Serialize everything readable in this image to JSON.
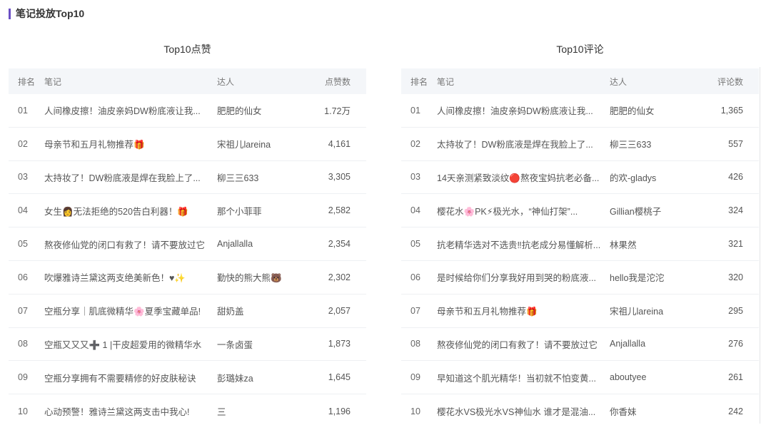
{
  "section_title": "笔记投放Top10",
  "accent_color": "#6a4fc4",
  "tables": [
    {
      "subtitle": "Top10点赞",
      "headers": {
        "rank": "排名",
        "note": "笔记",
        "author": "达人",
        "count": "点赞数"
      },
      "rows": [
        {
          "rank": "01",
          "note": "人间橡皮擦！油皮亲妈DW粉底液让我...",
          "author": "肥肥的仙女",
          "count": "1.72万"
        },
        {
          "rank": "02",
          "note": "母亲节和五月礼物推荐🎁",
          "author": "宋祖儿lareina",
          "count": "4,161"
        },
        {
          "rank": "03",
          "note": "太持妆了！DW粉底液是焊在我脸上了...",
          "author": "柳三三633",
          "count": "3,305"
        },
        {
          "rank": "04",
          "note": "女生👩无法拒绝的520告白利器！🎁",
          "author": "那个小菲菲",
          "count": "2,582"
        },
        {
          "rank": "05",
          "note": "熬夜修仙党的闭口有救了！请不要放过它",
          "author": "Anjallalla",
          "count": "2,354"
        },
        {
          "rank": "06",
          "note": "吹爆雅诗兰黛这两支绝美新色！♥✨",
          "author": "勤快的熊大熊🐻",
          "count": "2,302"
        },
        {
          "rank": "07",
          "note": "空瓶分享｜肌底微精华🌸夏季宝藏单品!",
          "author": "甜奶盖",
          "count": "2,057"
        },
        {
          "rank": "08",
          "note": "空瓶又又又➕ 1 |干皮超爱用的微精华水",
          "author": "一条卤蛋",
          "count": "1,873"
        },
        {
          "rank": "09",
          "note": "空瓶分享拥有不需要精修的好皮肤秘诀",
          "author": "彭璐妹za",
          "count": "1,645"
        },
        {
          "rank": "10",
          "note": "心动预警！雅诗兰黛这两支击中我心!",
          "author": "三",
          "count": "1,196"
        }
      ]
    },
    {
      "subtitle": "Top10评论",
      "headers": {
        "rank": "排名",
        "note": "笔记",
        "author": "达人",
        "count": "评论数"
      },
      "rows": [
        {
          "rank": "01",
          "note": "人间橡皮擦！油皮亲妈DW粉底液让我...",
          "author": "肥肥的仙女",
          "count": "1,365"
        },
        {
          "rank": "02",
          "note": "太持妆了！DW粉底液是焊在我脸上了...",
          "author": "柳三三633",
          "count": "557"
        },
        {
          "rank": "03",
          "note": "14天亲测紧致淡纹🔴熬夜宝妈抗老必备...",
          "author": "的欢-gladys",
          "count": "426"
        },
        {
          "rank": "04",
          "note": "樱花水🌸PK⚡极光水，“神仙打架”...",
          "author": "Gillian樱桃子",
          "count": "324"
        },
        {
          "rank": "05",
          "note": "抗老精华选对不选贵‼抗老成分易懂解析...",
          "author": "林果然",
          "count": "321"
        },
        {
          "rank": "06",
          "note": "是时候给你们分享我好用到哭的粉底液...",
          "author": "hello我是沱沱",
          "count": "320"
        },
        {
          "rank": "07",
          "note": "母亲节和五月礼物推荐🎁",
          "author": "宋祖儿lareina",
          "count": "295"
        },
        {
          "rank": "08",
          "note": "熬夜修仙党的闭口有救了！请不要放过它",
          "author": "Anjallalla",
          "count": "276"
        },
        {
          "rank": "09",
          "note": "早知道这个肌光精华！当初就不怕变黄...",
          "author": "aboutyee",
          "count": "261"
        },
        {
          "rank": "10",
          "note": "樱花水VS极光水VS神仙水 谁才是混油...",
          "author": "你香妹",
          "count": "242"
        }
      ]
    }
  ]
}
